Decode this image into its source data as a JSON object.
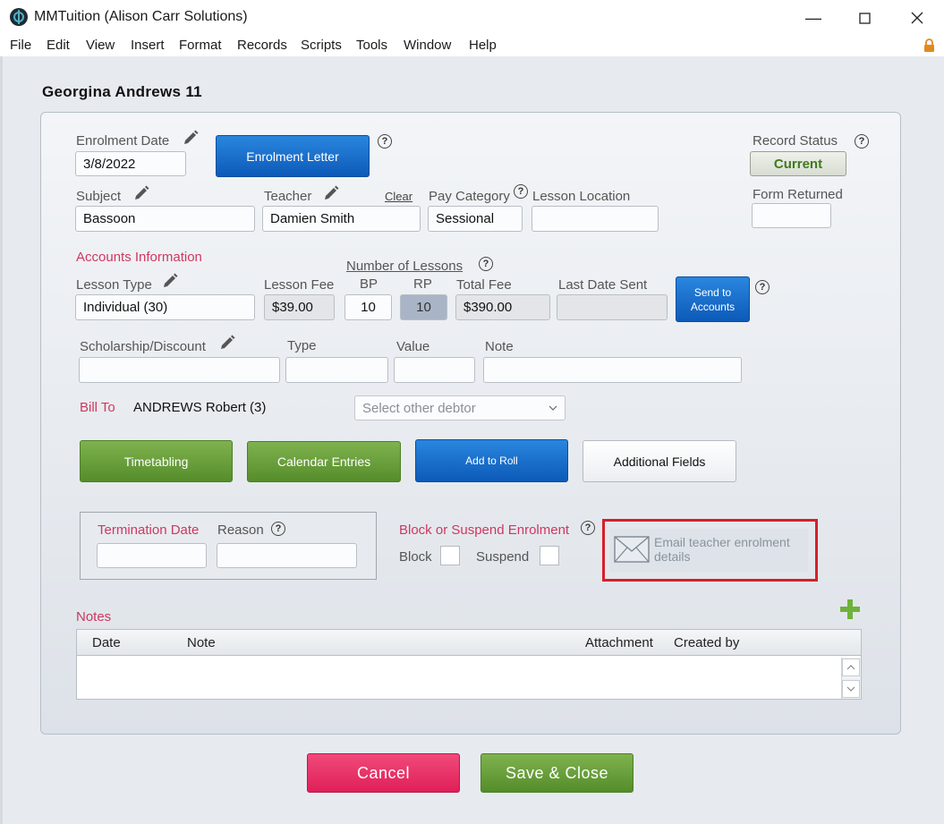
{
  "window": {
    "title": "MMTuition (Alison Carr Solutions)"
  },
  "menu": [
    "File",
    "Edit",
    "View",
    "Insert",
    "Format",
    "Records",
    "Scripts",
    "Tools",
    "Window",
    "Help"
  ],
  "student": {
    "name": "Georgina Andrews 11"
  },
  "enrolment": {
    "date_label": "Enrolment Date",
    "date_value": "3/8/2022",
    "letter_button": "Enrolment Letter",
    "record_status_label": "Record Status",
    "record_status_value": "Current",
    "form_returned_label": "Form Returned",
    "form_returned_value": ""
  },
  "subject": {
    "label": "Subject",
    "value": "Bassoon"
  },
  "teacher": {
    "label": "Teacher",
    "value": "Damien Smith",
    "clear_link": "Clear"
  },
  "pay_category": {
    "label": "Pay Category",
    "value": "Sessional"
  },
  "lesson_location": {
    "label": "Lesson Location",
    "value": ""
  },
  "accounts": {
    "section_label": "Accounts Information",
    "number_of_lessons_label": "Number of Lessons",
    "lesson_type_label": "Lesson Type",
    "lesson_type_value": "Individual (30)",
    "lesson_fee_label": "Lesson Fee",
    "lesson_fee_value": "$39.00",
    "bp_label": "BP",
    "bp_value": "10",
    "rp_label": "RP",
    "rp_value": "10",
    "total_fee_label": "Total Fee",
    "total_fee_value": "$390.00",
    "last_date_sent_label": "Last Date Sent",
    "last_date_sent_value": "",
    "send_button_line1": "Send to",
    "send_button_line2": "Accounts"
  },
  "scholarship": {
    "label": "Scholarship/Discount",
    "type_label": "Type",
    "value_label": "Value",
    "note_label": "Note"
  },
  "bill_to": {
    "label": "Bill To",
    "value": "ANDREWS Robert (3)",
    "select_placeholder": "Select other debtor"
  },
  "actions": {
    "timetabling": "Timetabling",
    "calendar_entries": "Calendar Entries",
    "add_to_roll": "Add to Roll",
    "additional_fields": "Additional Fields"
  },
  "termination": {
    "date_label": "Termination Date",
    "reason_label": "Reason"
  },
  "block_suspend": {
    "title": "Block or Suspend Enrolment",
    "block_label": "Block",
    "suspend_label": "Suspend"
  },
  "email_teacher": {
    "line1": "Email teacher enrolment",
    "line2": "details"
  },
  "notes": {
    "label": "Notes",
    "columns": [
      "Date",
      "Note",
      "Attachment",
      "Created by"
    ]
  },
  "footer": {
    "cancel": "Cancel",
    "save_close": "Save & Close"
  },
  "colors": {
    "accent_red": "#d0375f",
    "primary_blue": "#0c5ab8",
    "green": "#558d2a",
    "cancel_pink": "#e01f58",
    "highlight_red": "#d6202a"
  }
}
